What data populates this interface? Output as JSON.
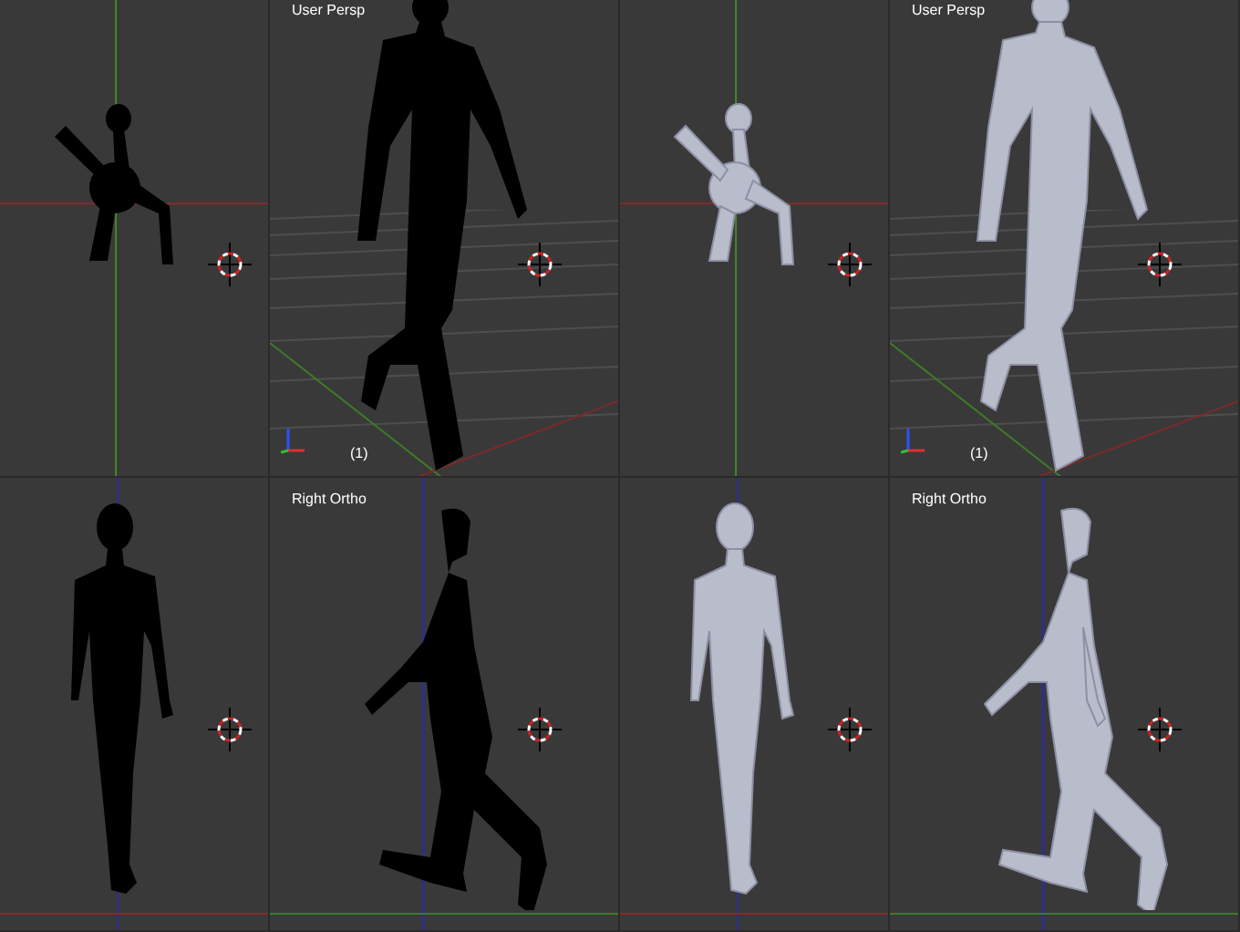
{
  "viewports": [
    {
      "kind": "top",
      "silhouette": true
    },
    {
      "kind": "persp",
      "silhouette": true,
      "label": "User Persp",
      "frame": "(1)"
    },
    {
      "kind": "top",
      "silhouette": false
    },
    {
      "kind": "persp",
      "silhouette": false,
      "label": "User Persp",
      "frame": "(1)"
    },
    {
      "kind": "front",
      "silhouette": true
    },
    {
      "kind": "side",
      "silhouette": true,
      "label": "Right Ortho"
    },
    {
      "kind": "front",
      "silhouette": false
    },
    {
      "kind": "side",
      "silhouette": false,
      "label": "Right Ortho"
    }
  ]
}
